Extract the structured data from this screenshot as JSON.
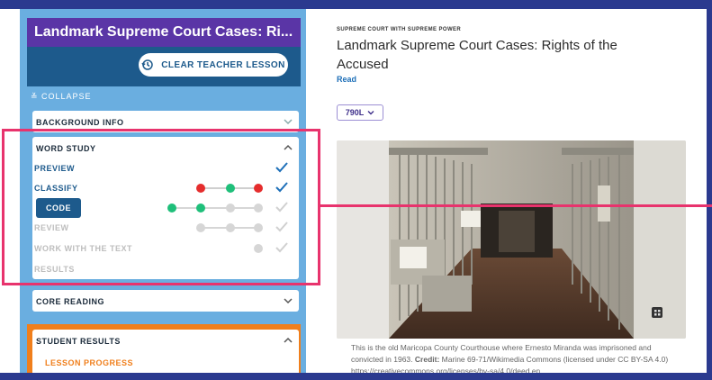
{
  "sidebar": {
    "title": "Landmark Supreme Court Cases: Ri...",
    "clear_button": "CLEAR TEACHER LESSON",
    "collapse": "≚ COLLAPSE",
    "background_info": "BACKGROUND INFO",
    "word_study": {
      "title": "WORD STUDY",
      "items": [
        {
          "label": "PREVIEW"
        },
        {
          "label": "CLASSIFY"
        },
        {
          "label": "CODE"
        },
        {
          "label": "REVIEW"
        },
        {
          "label": "WORK WITH THE TEXT"
        },
        {
          "label": "RESULTS"
        }
      ]
    },
    "core_reading": "CORE READING",
    "student_results": "STUDENT RESULTS",
    "lesson_progress": "LESSON PROGRESS",
    "colors": {
      "accent_blue": "#1d5a8c",
      "title_purple": "#5a35a6",
      "red": "#e52d2d",
      "green": "#1fbf7a",
      "gray": "#d6d6d6",
      "orange": "#f07f1c",
      "highlight": "#e8336d"
    }
  },
  "main": {
    "eyebrow": "SUPREME COURT WITH SUPREME POWER",
    "title": "Landmark Supreme Court Cases: Rights of the Accused",
    "read_link": "Read",
    "level": "790L",
    "caption_start": "This is the old Maricopa County Courthouse where Ernesto Miranda was imprisoned and convicted in 1963.",
    "caption_credit_label": "Credit:",
    "caption_credit": "Marine 69-71/Wikimedia Commons (licensed under CC BY-SA 4.0) https://creativecommons.org/licenses/by-sa/4.0/deed.en"
  }
}
